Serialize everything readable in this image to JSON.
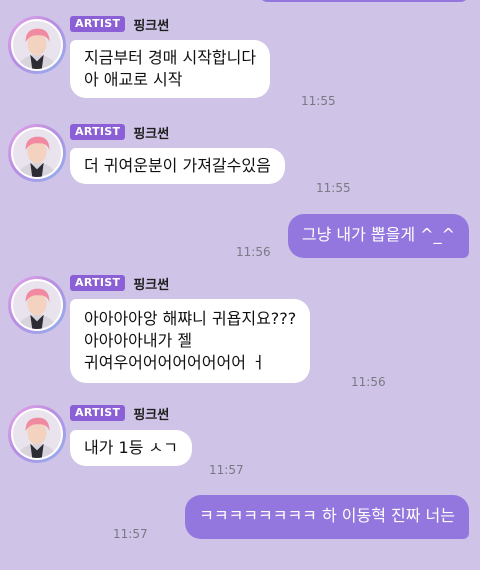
{
  "chat": {
    "colors": {
      "background": "#cfc3e7",
      "incoming_bubble": "#ffffff",
      "outgoing_bubble": "#9477de",
      "badge": "#8b5fd6"
    },
    "groups": [
      {
        "badge": "ARTIST",
        "name": "핑크썬",
        "lines": [
          "지금부터 경매 시작합니다",
          "아 애교로 시작"
        ],
        "time": "11:55"
      },
      {
        "badge": "ARTIST",
        "name": "핑크썬",
        "lines": [
          "더 귀여운분이 가져갈수있음"
        ],
        "time": "11:55"
      },
      {
        "badge": "ARTIST",
        "name": "핑크썬",
        "lines": [
          "아아아아앙 해쨔니 귀욥지요???",
          "아아아아내가 젤",
          "귀여우어어어어어어어어 ㅓ"
        ],
        "time": "11:56"
      },
      {
        "badge": "ARTIST",
        "name": "핑크썬",
        "lines": [
          "내가 1등 ㅅㄱ"
        ],
        "time": "11:57"
      }
    ],
    "outgoing": [
      {
        "text": "그냥 내가 뽑을게 ^_^",
        "time": "11:56"
      },
      {
        "text": "ㅋㅋㅋㅋㅋㅋㅋㅋ 하 이동혁 진짜 너는",
        "time": "11:57"
      }
    ]
  }
}
